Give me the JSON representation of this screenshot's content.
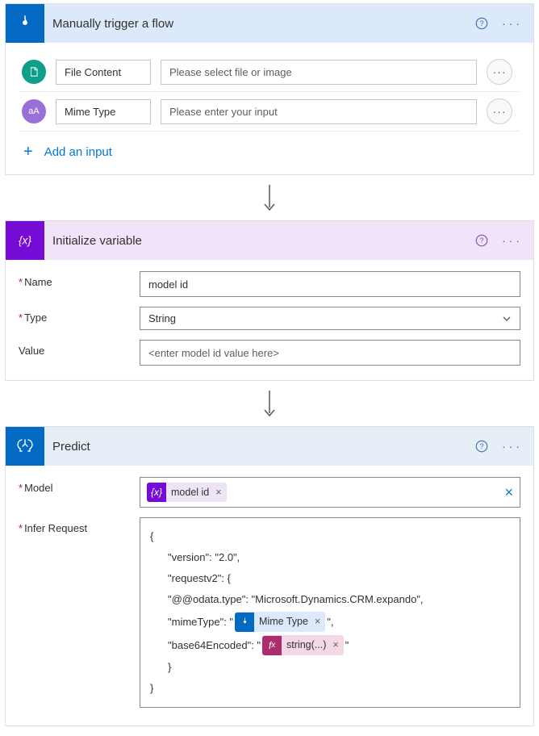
{
  "trigger": {
    "title": "Manually trigger a flow",
    "inputs": [
      {
        "label": "File Content",
        "placeholder": "Please select file or image",
        "badge": "file"
      },
      {
        "label": "Mime Type",
        "placeholder": "Please enter your input",
        "badge": "text"
      }
    ],
    "add_label": "Add an input"
  },
  "initVar": {
    "title": "Initialize variable",
    "fields": {
      "name_label": "Name",
      "name_value": "model id",
      "type_label": "Type",
      "type_value": "String",
      "value_label": "Value",
      "value_placeholder": "<enter model id value here>"
    }
  },
  "predict": {
    "title": "Predict",
    "model_label": "Model",
    "model_token": "model id",
    "infer_label": "Infer Request",
    "json": {
      "open": "{",
      "version": "\"version\": \"2.0\",",
      "requestv2": "\"requestv2\": {",
      "odata": "\"@@odata.type\": \"Microsoft.Dynamics.CRM.expando\",",
      "mime_pre": "\"mimeType\": \"",
      "mime_token": "Mime Type",
      "mime_post": "\",",
      "b64_pre": "\"base64Encoded\": \"",
      "b64_token": "string(...)",
      "b64_post": "\"",
      "close_inner": "}",
      "close": "}"
    }
  }
}
